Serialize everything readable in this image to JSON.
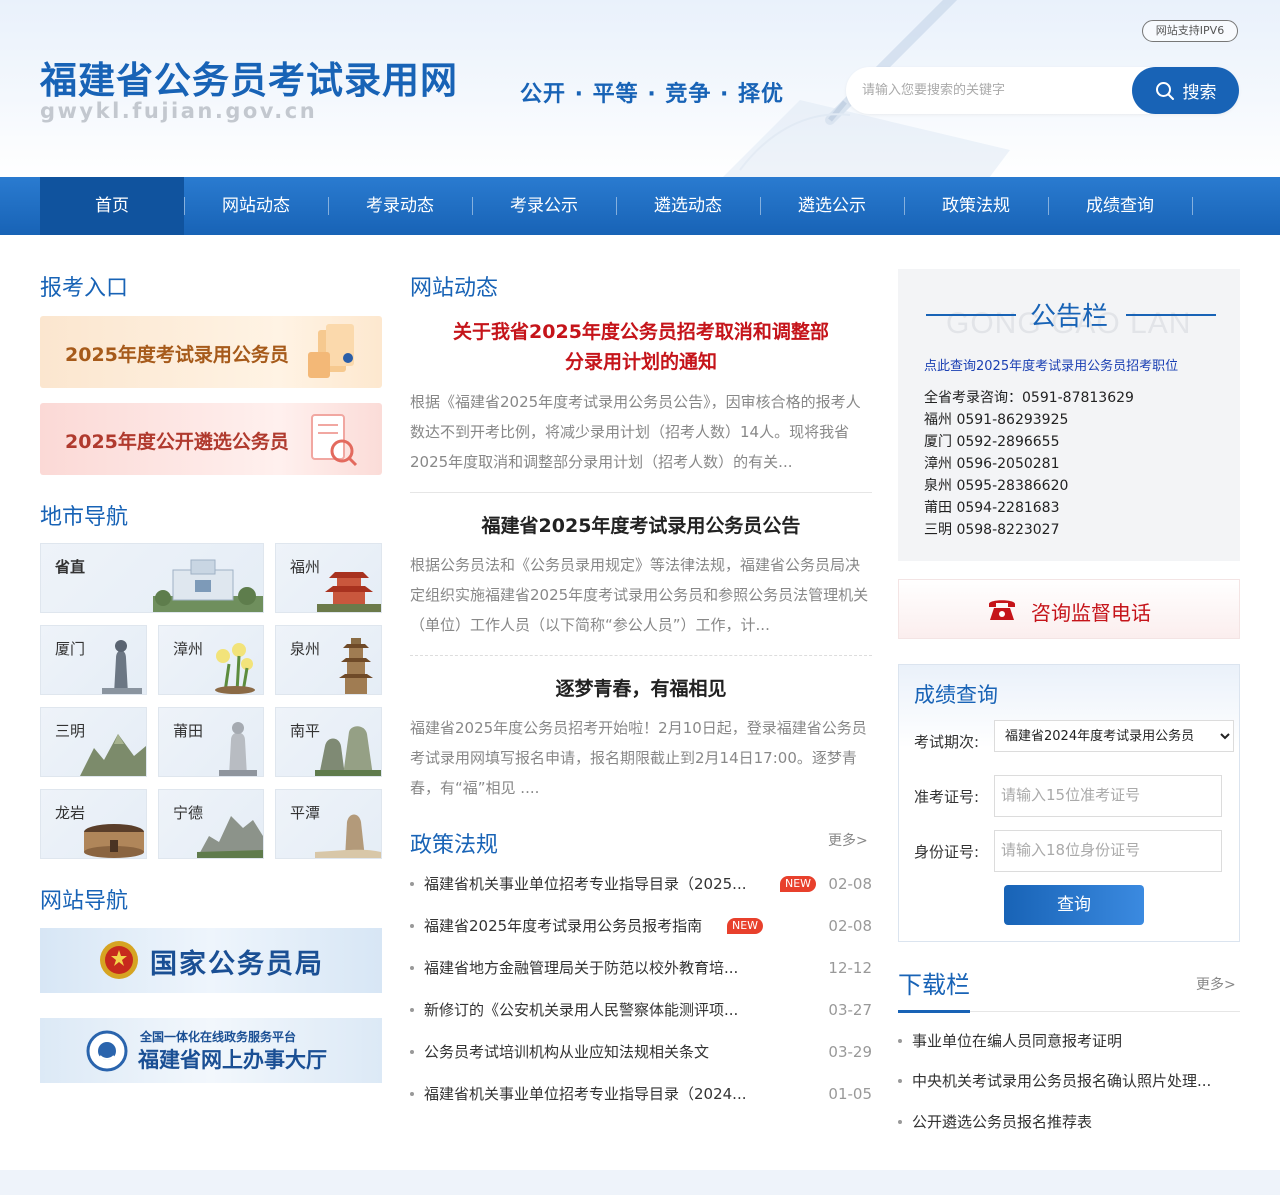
{
  "header": {
    "site_title": "福建省公务员考试录用网",
    "site_domain": "gwykl.fujian.gov.cn",
    "slogan": "公开 · 平等 · 竞争 · 择优",
    "ipv6_badge": "网站支持IPV6",
    "search": {
      "placeholder": "请输入您要搜索的关键字",
      "button_label": "搜索"
    }
  },
  "nav": {
    "items": [
      {
        "label": "首页",
        "active": true
      },
      {
        "label": "网站动态"
      },
      {
        "label": "考录动态"
      },
      {
        "label": "考录公示"
      },
      {
        "label": "遴选动态"
      },
      {
        "label": "遴选公示"
      },
      {
        "label": "政策法规"
      },
      {
        "label": "成绩查询"
      }
    ]
  },
  "left": {
    "entry_title": "报考入口",
    "entries": [
      {
        "label": "2025年度考试录用公务员"
      },
      {
        "label": "2025年度公开遴选公务员"
      }
    ],
    "city_title": "地市导航",
    "cities": [
      "省直",
      "福州",
      "厦门",
      "漳州",
      "泉州",
      "三明",
      "莆田",
      "南平",
      "龙岩",
      "宁德",
      "平潭"
    ],
    "site_nav_title": "网站导航",
    "site_nav": {
      "banner1": "国家公务员局",
      "banner2_top": "全国一体化在线政务服务平台",
      "banner2_main": "福建省网上办事大厅"
    }
  },
  "middle": {
    "news_title": "网站动态",
    "news": [
      {
        "title_line1": "关于我省2025年度公务员招考取消和调整部",
        "title_line2": "分录用计划的通知",
        "summary": "根据《福建省2025年度考试录用公务员公告》，因审核合格的报考人数达不到开考比例，将减少录用计划（招考人数）14人。现将我省2025年度取消和调整部分录用计划（招考人数）的有关..."
      },
      {
        "title": "福建省2025年度考试录用公务员公告",
        "summary": "根据公务员法和《公务员录用规定》等法律法规，福建省公务员局决定组织实施福建省2025年度考试录用公务员和参照公务员法管理机关（单位）工作人员（以下简称“参公人员”）工作，计..."
      },
      {
        "title": "逐梦青春，有福相见",
        "summary": "福建省2025年度公务员招考开始啦！2月10日起，登录福建省公务员考试录用网填写报名申请，报名期限截止到2月14日17:00。逐梦青春，有“福”相见 ...."
      }
    ],
    "policy_title": "政策法规",
    "policy_more": "更多>",
    "policy": [
      {
        "title": "福建省机关事业单位招考专业指导目录（2025...",
        "new": "NEW",
        "date": "02-08"
      },
      {
        "title": "福建省2025年度考试录用公务员报考指南",
        "new": "NEW",
        "date": "02-08"
      },
      {
        "title": "福建省地方金融管理局关于防范以校外教育培...",
        "date": "12-12"
      },
      {
        "title": "新修订的《公安机关录用人民警察体能测评项...",
        "date": "03-27"
      },
      {
        "title": "公务员考试培训机构从业应知法规相关条文",
        "date": "03-29"
      },
      {
        "title": "福建省机关事业单位招考专业指导目录（2024...",
        "date": "01-05"
      }
    ]
  },
  "right": {
    "notice": {
      "title": "公告栏",
      "bg_text": "GONG GAO LAN",
      "link": "点此查询2025年度考试录用公务员招考职位",
      "phones": [
        "全省考录咨询：0591-87813629",
        "福州 0591-86293925",
        "厦门 0592-2896655",
        "漳州 0596-2050281",
        "泉州 0595-28386620",
        "莆田 0594-2281683",
        "三明 0598-8223027"
      ]
    },
    "hotline": "咨询监督电话",
    "score": {
      "title": "成绩查询",
      "period_label": "考试期次:",
      "period_value": "福建省2024年度考试录用公务员",
      "ticket_label": "准考证号:",
      "ticket_placeholder": "请输入15位准考证号",
      "id_label": "身份证号:",
      "id_placeholder": "请输入18位身份证号",
      "button": "查询"
    },
    "download": {
      "title": "下载栏",
      "more": "更多>",
      "items": [
        "事业单位在编人员同意报考证明",
        "中央机关考试录用公务员报名确认照片处理...",
        "公开遴选公务员报名推荐表"
      ]
    }
  },
  "colors": {
    "brand": "#1863b6",
    "alert_red": "#c5141a",
    "new_badge": "#e8402c"
  }
}
